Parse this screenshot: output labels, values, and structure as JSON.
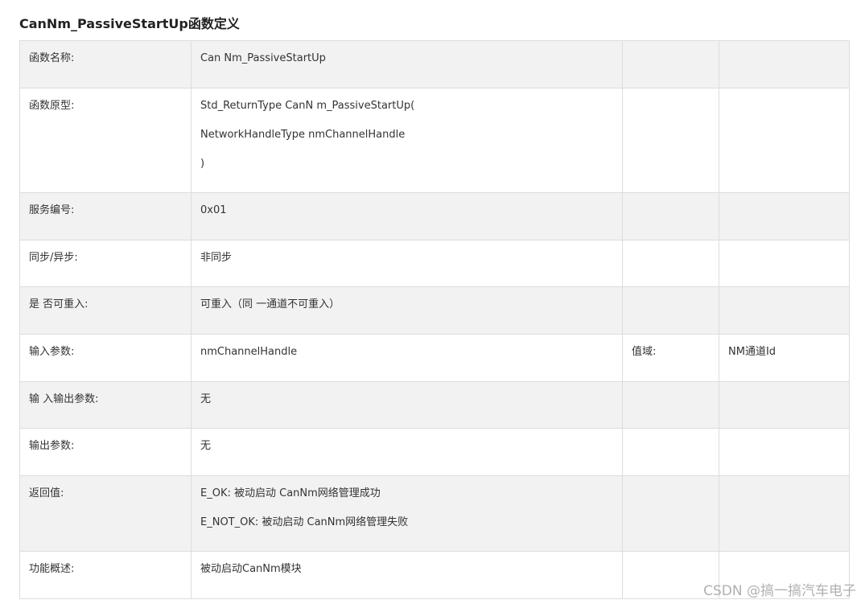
{
  "title": "CanNm_PassiveStartUp函数定义",
  "rows": [
    {
      "label": "函数名称:",
      "value_lines": [
        "Can Nm_PassiveStartUp"
      ],
      "c3": "",
      "c4": ""
    },
    {
      "label": "函数原型:",
      "value_lines": [
        "Std_ReturnType CanN m_PassiveStartUp(",
        "NetworkHandleType nmChannelHandle",
        ")"
      ],
      "c3": "",
      "c4": ""
    },
    {
      "label": "服务编号:",
      "value_lines": [
        "0x01"
      ],
      "c3": "",
      "c4": ""
    },
    {
      "label": "同步/异步:",
      "value_lines": [
        "非同步"
      ],
      "c3": "",
      "c4": ""
    },
    {
      "label": "是 否可重入:",
      "value_lines": [
        "可重入（同 一通道不可重入）"
      ],
      "c3": "",
      "c4": ""
    },
    {
      "label": "输入参数:",
      "value_lines": [
        "nmChannelHandle"
      ],
      "c3": "值域:",
      "c4": "NM通道Id"
    },
    {
      "label": "输 入输出参数:",
      "value_lines": [
        "无"
      ],
      "c3": "",
      "c4": ""
    },
    {
      "label": "输出参数:",
      "value_lines": [
        "无"
      ],
      "c3": "",
      "c4": ""
    },
    {
      "label": "返回值:",
      "value_lines": [
        "E_OK: 被动启动 CanNm网络管理成功",
        "E_NOT_OK: 被动启动 CanNm网络管理失败"
      ],
      "c3": "",
      "c4": ""
    },
    {
      "label": "功能概述:",
      "value_lines": [
        "被动启动CanNm模块"
      ],
      "c3": "",
      "c4": ""
    }
  ],
  "watermark": "CSDN @搞一搞汽车电子"
}
